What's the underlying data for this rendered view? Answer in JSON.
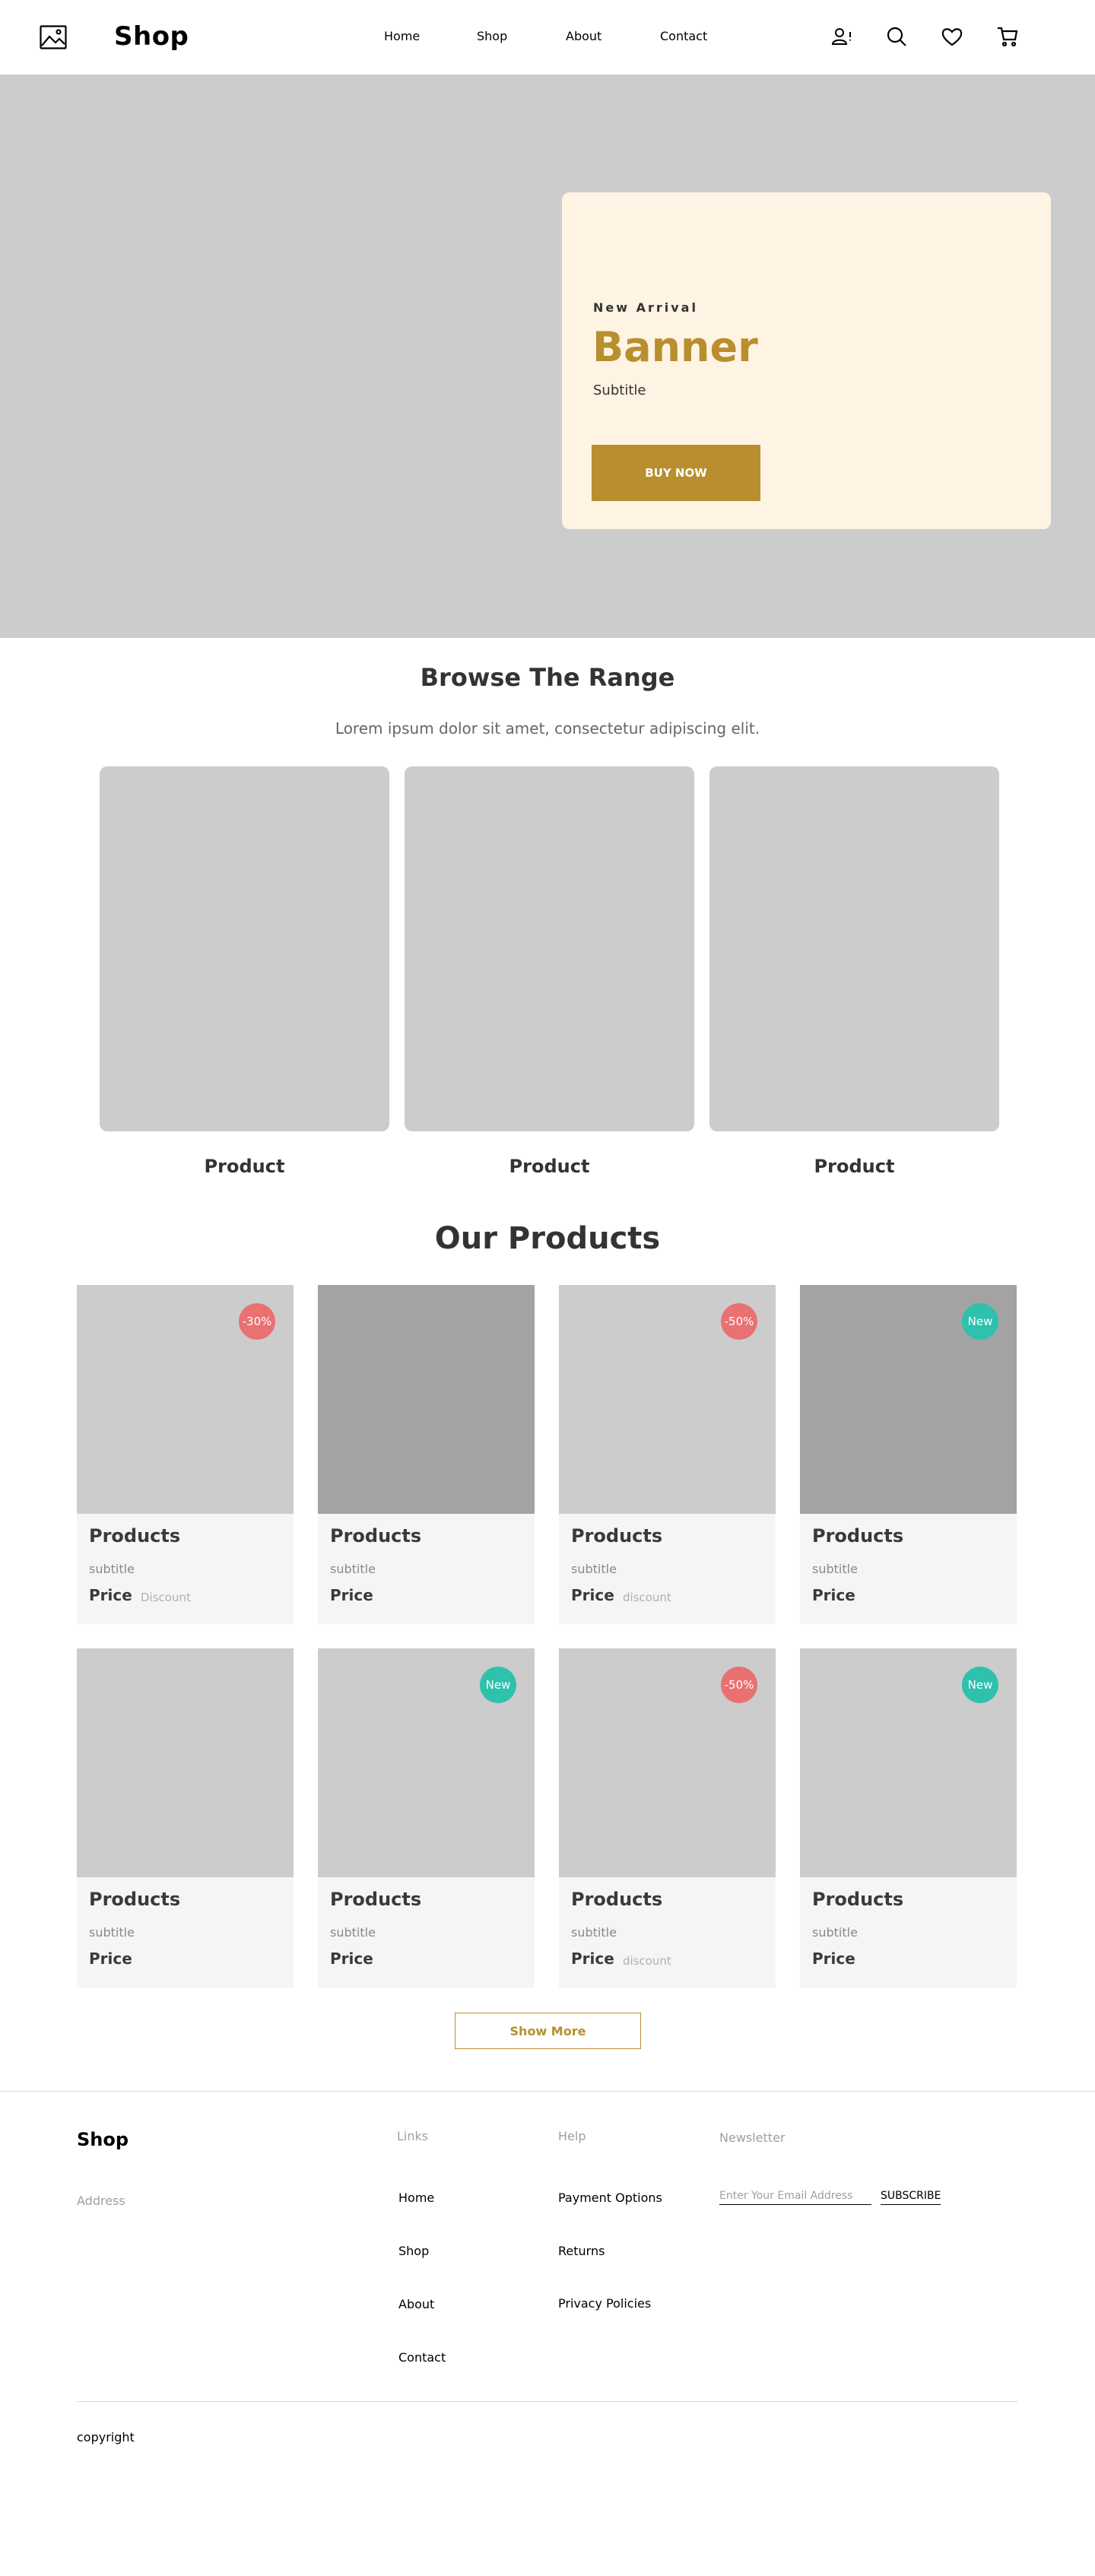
{
  "header": {
    "brand": "Shop",
    "nav": [
      {
        "label": "Home"
      },
      {
        "label": "Shop"
      },
      {
        "label": "About"
      },
      {
        "label": "Contact"
      }
    ],
    "icons": [
      "user-alert-icon",
      "search-icon",
      "heart-icon",
      "cart-icon"
    ]
  },
  "hero": {
    "eyebrow": "New Arrival",
    "title": "Banner",
    "subtitle": "Subtitle",
    "cta": "BUY NOW"
  },
  "browse": {
    "title": "Browse The Range",
    "subtitle": "Lorem ipsum dolor sit amet, consectetur adipiscing elit.",
    "items": [
      {
        "label": "Product"
      },
      {
        "label": "Product"
      },
      {
        "label": "Product"
      }
    ]
  },
  "products": {
    "title": "Our Products",
    "items": [
      {
        "name": "Products",
        "subtitle": "subtitle",
        "price": "Price",
        "discount": "Discount",
        "badge": "-30%",
        "badge_type": "sale"
      },
      {
        "name": "Products",
        "subtitle": "subtitle",
        "price": "Price",
        "discount": "",
        "badge": "",
        "badge_type": ""
      },
      {
        "name": "Products",
        "subtitle": "subtitle",
        "price": "Price",
        "discount": "discount",
        "badge": "-50%",
        "badge_type": "sale"
      },
      {
        "name": "Products",
        "subtitle": "subtitle",
        "price": "Price",
        "discount": "",
        "badge": "New",
        "badge_type": "new"
      },
      {
        "name": "Products",
        "subtitle": "subtitle",
        "price": "Price",
        "discount": "",
        "badge": "",
        "badge_type": ""
      },
      {
        "name": "Products",
        "subtitle": "subtitle",
        "price": "Price",
        "discount": "",
        "badge": "New",
        "badge_type": "new"
      },
      {
        "name": "Products",
        "subtitle": "subtitle",
        "price": "Price",
        "discount": "discount",
        "badge": "-50%",
        "badge_type": "sale"
      },
      {
        "name": "Products",
        "subtitle": "subtitle",
        "price": "Price",
        "discount": "",
        "badge": "New",
        "badge_type": "new"
      }
    ],
    "show_more": "Show More"
  },
  "footer": {
    "brand": "Shop",
    "address": "Address",
    "links_heading": "Links",
    "links": [
      "Home",
      "Shop",
      "About",
      "Contact"
    ],
    "help_heading": "Help",
    "help": [
      "Payment Options",
      "Returns",
      "Privacy Policies"
    ],
    "newsletter_heading": "Newsletter",
    "email_placeholder": "Enter Your Email Address",
    "subscribe": "SUBSCRIBE",
    "copyright": "copyright"
  },
  "colors": {
    "accent": "#b88e2f",
    "sale_badge": "#e97171",
    "new_badge": "#2ec1ac",
    "hero_card": "#fff3e3",
    "placeholder": "#cccccc"
  }
}
